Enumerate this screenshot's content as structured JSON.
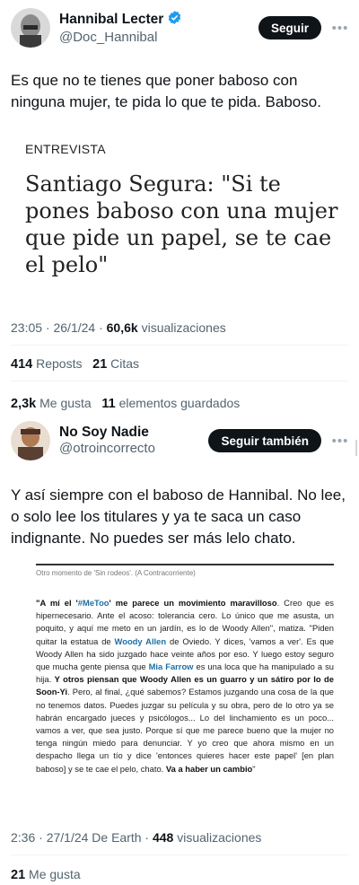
{
  "tweet1": {
    "display_name": "Hannibal Lecter",
    "handle": "@Doc_Hannibal",
    "follow_label": "Seguir",
    "text": "Es que no te tienes que poner baboso con ninguna mujer, te pida lo que te pida. Baboso.",
    "article": {
      "kicker": "ENTREVISTA",
      "title": "Santiago Segura: \"Si te pones baboso con una mujer que pide un papel, se te cae el pelo\""
    },
    "time": "23:05 · 26/1/24 · ",
    "views_count": "60,6k",
    "views_label": " visualizaciones",
    "reposts_count": "414",
    "reposts_label": "Reposts",
    "quotes_count": "21",
    "quotes_label": "Citas",
    "likes_count": "2,3k",
    "likes_label": "Me gusta",
    "bookmarks_count": "11",
    "bookmarks_label": "elementos guardados"
  },
  "tweet2": {
    "display_name": "No Soy Nadie",
    "handle": "@otroincorrecto",
    "follow_label": "Seguir también",
    "text": "Y así siempre con el baboso de Hannibal. No lee, o solo lee los titulares y ya te saca un caso indignante. No puedes ser más lelo chato.",
    "clipping": {
      "caption": "Otro momento de 'Sin rodeos'. (A Contracorriente)",
      "p1": "\"A mí el '",
      "p2": "#MeToo",
      "p3": "' me parece un movimiento maravilloso",
      "p4": ". Creo que es hipernecesario. Ante el acoso: tolerancia cero. Lo único que me asusta, un poquito, y aquí me meto en un jardín, es lo de Woody Allen\", matiza. \"Piden quitar la estatua de ",
      "p5": "Woody Allen",
      "p6": " de Oviedo. Y dices, 'vamos a ver'. Es que Woody Allen ha sido juzgado hace veinte años por eso. Y luego estoy seguro que mucha gente piensa que ",
      "p7": "Mia Farrow",
      "p8": " es una loca que ha manipulado a su hija. ",
      "p9": "Y otros piensan que Woody Allen es un guarro y un sátiro por lo de Soon-Yi",
      "p10": ". Pero, al final, ¿qué sabemos? Estamos juzgando una cosa de la que no tenemos datos. Puedes juzgar su película y su obra, pero de lo otro ya se habrán encargado jueces y psicólogos... Lo del linchamiento es un poco... vamos a ver, que sea justo. Porque sí que me parece bueno que la mujer no tenga ningún miedo para denunciar. Y yo creo que ahora mismo en un despacho llega un tío y dice 'entonces quieres hacer este papel' [en plan baboso] y se te cae el pelo, chato. ",
      "p11": "Va a haber un cambio",
      "p12": "\""
    },
    "time": "2:36 · 27/1/24 De Earth · ",
    "views_count": "448",
    "views_label": " visualizaciones",
    "likes_count": "21",
    "likes_label": "Me gusta"
  },
  "colors": {
    "verified": "#1d9bf0",
    "text": "#0f1419",
    "secondary": "#536471",
    "button": "#0f1419"
  }
}
